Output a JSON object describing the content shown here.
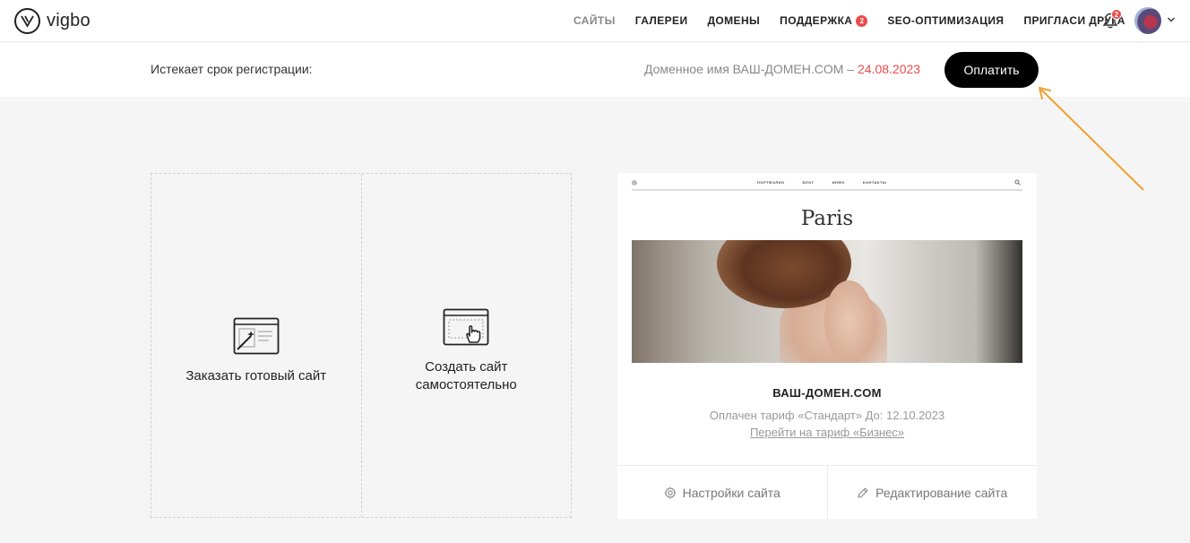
{
  "header": {
    "logo_text": "vigbo",
    "nav": [
      {
        "label": "САЙТЫ",
        "active": true
      },
      {
        "label": "ГАЛЕРЕИ"
      },
      {
        "label": "ДОМЕНЫ"
      },
      {
        "label": "ПОДДЕРЖКА",
        "badge": "2"
      },
      {
        "label": "SEO-ОПТИМИЗАЦИЯ"
      },
      {
        "label": "ПРИГЛАСИ ДРУГА"
      }
    ],
    "notifications_count": "2"
  },
  "expiration": {
    "label": "Истекает срок регистрации:",
    "domain_text": "Доменное имя ВАШ-ДОМЕН.COM –",
    "date": "24.08.2023",
    "pay_button": "Оплатить"
  },
  "create": {
    "order_site": "Заказать готовый сайт",
    "build_self": "Создать сайт самостоятельно"
  },
  "site": {
    "preview": {
      "menu": [
        "ПОРТФОЛИО",
        "БЛОГ",
        "ИНФО",
        "КОНТАКТЫ"
      ],
      "title": "Paris"
    },
    "domain": "ВАШ-ДОМЕН.COM",
    "plan": "Оплачен тариф «Стандарт» До: 12.10.2023",
    "upgrade_link": "Перейти на тариф «Бизнес»",
    "settings_button": "Настройки сайта",
    "edit_button": "Редактирование сайта"
  },
  "colors": {
    "accent_red": "#e94b4b",
    "arrow": "#f0a030",
    "button": "#000000"
  }
}
